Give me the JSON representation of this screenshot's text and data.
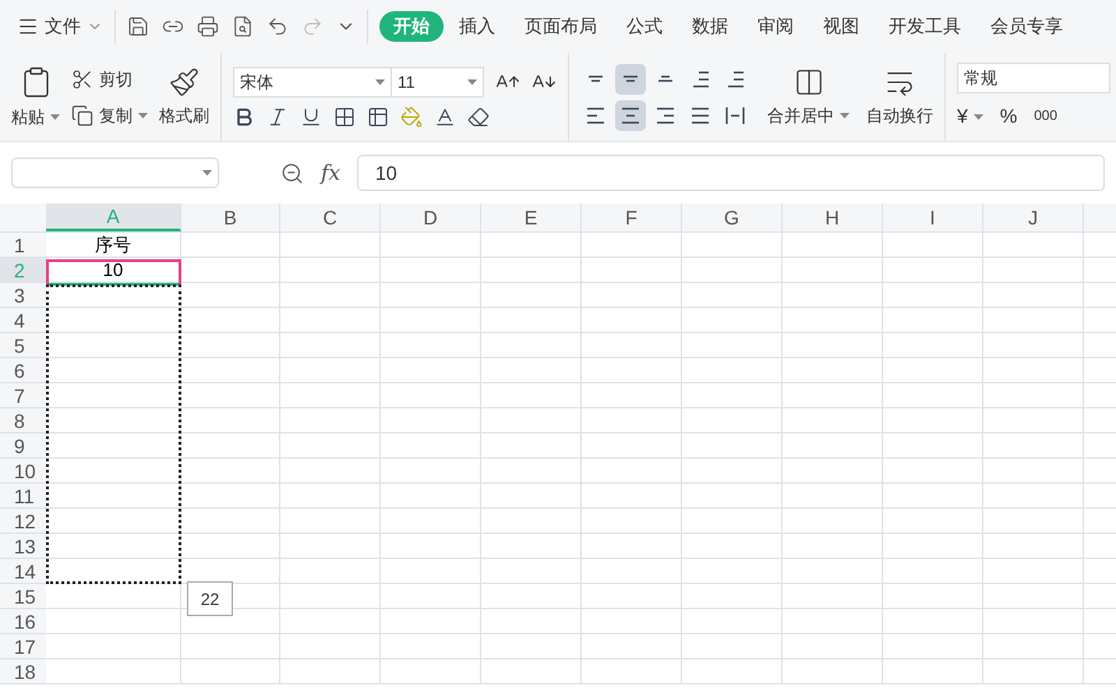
{
  "menu": {
    "file": "文件",
    "tabs": [
      {
        "label": "开始",
        "selected": true
      },
      {
        "label": "插入",
        "selected": false
      },
      {
        "label": "页面布局",
        "selected": false
      },
      {
        "label": "公式",
        "selected": false
      },
      {
        "label": "数据",
        "selected": false
      },
      {
        "label": "审阅",
        "selected": false
      },
      {
        "label": "视图",
        "selected": false
      },
      {
        "label": "开发工具",
        "selected": false
      },
      {
        "label": "会员专享",
        "selected": false
      }
    ]
  },
  "ribbon": {
    "paste": "粘贴",
    "cut": "剪切",
    "copy": "复制",
    "format_painter": "格式刷",
    "font": "宋体",
    "size": "11",
    "merge": "合并居中",
    "wrap": "自动换行",
    "number_format": "常规",
    "currency": "¥",
    "percent": "%",
    "thousands": "000",
    "align_top": [
      {
        "kind": "top",
        "selected": false
      },
      {
        "kind": "middle",
        "selected": true
      },
      {
        "kind": "bottom",
        "selected": false
      },
      {
        "kind": "outdent",
        "selected": false
      },
      {
        "kind": "indent",
        "selected": false
      }
    ],
    "align_bottom": [
      {
        "kind": "left",
        "selected": false
      },
      {
        "kind": "center",
        "selected": true
      },
      {
        "kind": "right",
        "selected": false
      },
      {
        "kind": "justify",
        "selected": false
      },
      {
        "kind": "distributed",
        "selected": false
      }
    ]
  },
  "formula_bar": {
    "function_label": "fx",
    "value": "10"
  },
  "sheet": {
    "columns": [
      {
        "label": "A",
        "selected": true
      },
      {
        "label": "B",
        "selected": false
      },
      {
        "label": "C",
        "selected": false
      },
      {
        "label": "D",
        "selected": false
      },
      {
        "label": "E",
        "selected": false
      },
      {
        "label": "F",
        "selected": false
      },
      {
        "label": "G",
        "selected": false
      },
      {
        "label": "H",
        "selected": false
      },
      {
        "label": "I",
        "selected": false
      },
      {
        "label": "J",
        "selected": false
      }
    ],
    "rows": [
      {
        "label": "1",
        "selected": false,
        "cells": [
          "序号"
        ]
      },
      {
        "label": "2",
        "selected": true,
        "cells": [
          "10"
        ]
      },
      {
        "label": "3",
        "selected": false
      },
      {
        "label": "4",
        "selected": false
      },
      {
        "label": "5",
        "selected": false
      },
      {
        "label": "6",
        "selected": false
      },
      {
        "label": "7",
        "selected": false
      },
      {
        "label": "8",
        "selected": false
      },
      {
        "label": "9",
        "selected": false
      },
      {
        "label": "10",
        "selected": false
      },
      {
        "label": "11",
        "selected": false
      },
      {
        "label": "12",
        "selected": false
      },
      {
        "label": "13",
        "selected": false
      },
      {
        "label": "14",
        "selected": false
      },
      {
        "label": "15",
        "selected": false
      },
      {
        "label": "16",
        "selected": false
      },
      {
        "label": "17",
        "selected": false
      },
      {
        "label": "18",
        "selected": false
      }
    ],
    "fill_tooltip": "22"
  }
}
